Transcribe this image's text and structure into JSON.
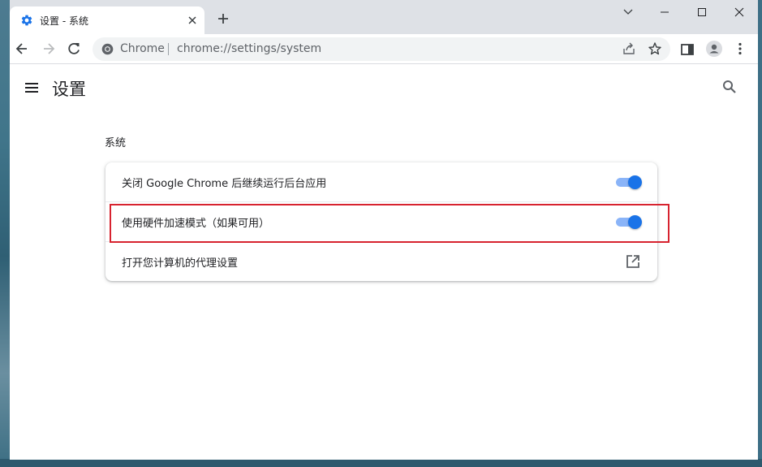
{
  "tab": {
    "title": "设置 - 系统",
    "favicon": "gear-icon"
  },
  "window_controls": [
    "tab-search-icon",
    "minimize-icon",
    "maximize-icon",
    "close-icon"
  ],
  "omnibox": {
    "site_label": "Chrome",
    "url": "chrome://settings/system"
  },
  "settings": {
    "title": "设置",
    "section_title": "系统",
    "rows": [
      {
        "label": "关闭 Google Chrome 后继续运行后台应用",
        "control": "toggle",
        "enabled": true
      },
      {
        "label": "使用硬件加速模式（如果可用）",
        "control": "toggle",
        "enabled": true
      },
      {
        "label": "打开您计算机的代理设置",
        "control": "external-link-icon"
      }
    ]
  },
  "colors": {
    "accent": "#1a73e8",
    "toggle_track": "#8ab4f8",
    "highlight_box": "#d7232f",
    "titlebar": "#dee1e6"
  }
}
